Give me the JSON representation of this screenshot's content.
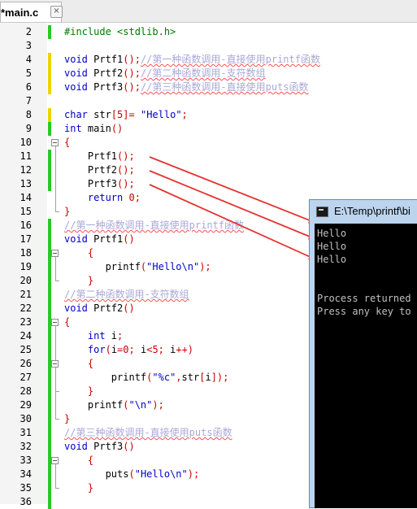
{
  "tab": {
    "title": "*main.c",
    "close_glyph": "×"
  },
  "lines": [
    {
      "n": "2",
      "segs": [
        {
          "c": "pp",
          "t": "#include <stdlib.h>"
        }
      ]
    },
    {
      "n": "3",
      "segs": []
    },
    {
      "n": "4",
      "segs": [
        {
          "c": "kw",
          "t": "void"
        },
        {
          "c": "fn",
          "t": " Prtf1"
        },
        {
          "c": "pu",
          "t": "();"
        },
        {
          "c": "cm",
          "t": "//第一种函数调用-直接使用printf函数"
        }
      ]
    },
    {
      "n": "5",
      "segs": [
        {
          "c": "kw",
          "t": "void"
        },
        {
          "c": "fn",
          "t": " Prtf2"
        },
        {
          "c": "pu",
          "t": "();"
        },
        {
          "c": "cm",
          "t": "//第二种函数调用-支符数组"
        }
      ]
    },
    {
      "n": "6",
      "segs": [
        {
          "c": "kw",
          "t": "void"
        },
        {
          "c": "fn",
          "t": " Prtf3"
        },
        {
          "c": "pu",
          "t": "();"
        },
        {
          "c": "cm",
          "t": "//第三种函数调用-直接使用puts函数"
        }
      ]
    },
    {
      "n": "7",
      "segs": []
    },
    {
      "n": "8",
      "segs": [
        {
          "c": "kw",
          "t": "char"
        },
        {
          "c": "fn",
          "t": " str"
        },
        {
          "c": "pu",
          "t": "["
        },
        {
          "c": "nm",
          "t": "5"
        },
        {
          "c": "pu",
          "t": "]="
        },
        {
          "c": "fn",
          "t": " "
        },
        {
          "c": "st",
          "t": "\"Hello\""
        },
        {
          "c": "pu",
          "t": ";"
        }
      ]
    },
    {
      "n": "9",
      "segs": [
        {
          "c": "kw",
          "t": "int"
        },
        {
          "c": "fn",
          "t": " main"
        },
        {
          "c": "pu",
          "t": "()"
        }
      ]
    },
    {
      "n": "10",
      "segs": [
        {
          "c": "pu",
          "t": "{"
        }
      ]
    },
    {
      "n": "11",
      "segs": [
        {
          "c": "fn",
          "t": "    Prtf1"
        },
        {
          "c": "pu",
          "t": "();"
        }
      ]
    },
    {
      "n": "12",
      "segs": [
        {
          "c": "fn",
          "t": "    Prtf2"
        },
        {
          "c": "pu",
          "t": "();"
        }
      ]
    },
    {
      "n": "13",
      "segs": [
        {
          "c": "fn",
          "t": "    Prtf3"
        },
        {
          "c": "pu",
          "t": "();"
        }
      ]
    },
    {
      "n": "14",
      "segs": [
        {
          "c": "kw",
          "t": "    return"
        },
        {
          "c": "fn",
          "t": " "
        },
        {
          "c": "nm",
          "t": "0"
        },
        {
          "c": "pu",
          "t": ";"
        }
      ]
    },
    {
      "n": "15",
      "segs": [
        {
          "c": "pu",
          "t": "}"
        }
      ]
    },
    {
      "n": "16",
      "segs": [
        {
          "c": "cm",
          "t": "//第一种函数调用-直接使用printf函数"
        }
      ]
    },
    {
      "n": "17",
      "segs": [
        {
          "c": "kw",
          "t": "void"
        },
        {
          "c": "fn",
          "t": " Prtf1"
        },
        {
          "c": "pu",
          "t": "()"
        }
      ]
    },
    {
      "n": "18",
      "segs": [
        {
          "c": "pu",
          "t": "    {"
        }
      ]
    },
    {
      "n": "19",
      "segs": [
        {
          "c": "fn",
          "t": "       printf"
        },
        {
          "c": "pu",
          "t": "("
        },
        {
          "c": "st",
          "t": "\"Hello\\n\""
        },
        {
          "c": "pu",
          "t": ");"
        }
      ]
    },
    {
      "n": "20",
      "segs": [
        {
          "c": "pu",
          "t": "    }"
        }
      ]
    },
    {
      "n": "21",
      "segs": [
        {
          "c": "cm",
          "t": "//第二种函数调用-支符数组"
        }
      ]
    },
    {
      "n": "22",
      "segs": [
        {
          "c": "kw",
          "t": "void"
        },
        {
          "c": "fn",
          "t": " Prtf2"
        },
        {
          "c": "pu",
          "t": "()"
        }
      ]
    },
    {
      "n": "23",
      "segs": [
        {
          "c": "pu",
          "t": "{"
        }
      ]
    },
    {
      "n": "24",
      "segs": [
        {
          "c": "kw",
          "t": "    int"
        },
        {
          "c": "fn",
          "t": " i"
        },
        {
          "c": "pu",
          "t": ";"
        }
      ]
    },
    {
      "n": "25",
      "segs": [
        {
          "c": "kw",
          "t": "    for"
        },
        {
          "c": "pu",
          "t": "("
        },
        {
          "c": "fn",
          "t": "i"
        },
        {
          "c": "pu",
          "t": "="
        },
        {
          "c": "nm",
          "t": "0"
        },
        {
          "c": "pu",
          "t": "; "
        },
        {
          "c": "fn",
          "t": "i"
        },
        {
          "c": "pu",
          "t": "<"
        },
        {
          "c": "nm",
          "t": "5"
        },
        {
          "c": "pu",
          "t": "; "
        },
        {
          "c": "fn",
          "t": "i"
        },
        {
          "c": "pu",
          "t": "++)"
        }
      ]
    },
    {
      "n": "26",
      "segs": [
        {
          "c": "pu",
          "t": "    {"
        }
      ]
    },
    {
      "n": "27",
      "segs": [
        {
          "c": "fn",
          "t": "        printf"
        },
        {
          "c": "pu",
          "t": "("
        },
        {
          "c": "st",
          "t": "\"%c\""
        },
        {
          "c": "pu",
          "t": ","
        },
        {
          "c": "fn",
          "t": "str"
        },
        {
          "c": "pu",
          "t": "["
        },
        {
          "c": "fn",
          "t": "i"
        },
        {
          "c": "pu",
          "t": "]);"
        }
      ]
    },
    {
      "n": "28",
      "segs": [
        {
          "c": "pu",
          "t": "    }"
        }
      ]
    },
    {
      "n": "29",
      "segs": [
        {
          "c": "fn",
          "t": "    printf"
        },
        {
          "c": "pu",
          "t": "("
        },
        {
          "c": "st",
          "t": "\"\\n\""
        },
        {
          "c": "pu",
          "t": ");"
        }
      ]
    },
    {
      "n": "30",
      "segs": [
        {
          "c": "pu",
          "t": "}"
        }
      ]
    },
    {
      "n": "31",
      "segs": [
        {
          "c": "cm",
          "t": "//第三种函数调用-直接使用puts函数"
        }
      ]
    },
    {
      "n": "32",
      "segs": [
        {
          "c": "kw",
          "t": "void"
        },
        {
          "c": "fn",
          "t": " Prtf3"
        },
        {
          "c": "pu",
          "t": "()"
        }
      ]
    },
    {
      "n": "33",
      "segs": [
        {
          "c": "pu",
          "t": "    {"
        }
      ]
    },
    {
      "n": "34",
      "segs": [
        {
          "c": "fn",
          "t": "       puts"
        },
        {
          "c": "pu",
          "t": "("
        },
        {
          "c": "st",
          "t": "\"Hello\\n\""
        },
        {
          "c": "pu",
          "t": ");"
        }
      ]
    },
    {
      "n": "35",
      "segs": [
        {
          "c": "pu",
          "t": "    }"
        }
      ]
    },
    {
      "n": "36",
      "segs": []
    }
  ],
  "console": {
    "title": "E:\\Temp\\printf\\bi",
    "lines": [
      "Hello",
      "Hello",
      "Hello",
      "",
      "",
      "Process returned",
      "Press any key to"
    ]
  },
  "colors": {
    "arrow": "#e63232",
    "change_bar": "#28c828",
    "saved_bar": "#f0d200"
  }
}
